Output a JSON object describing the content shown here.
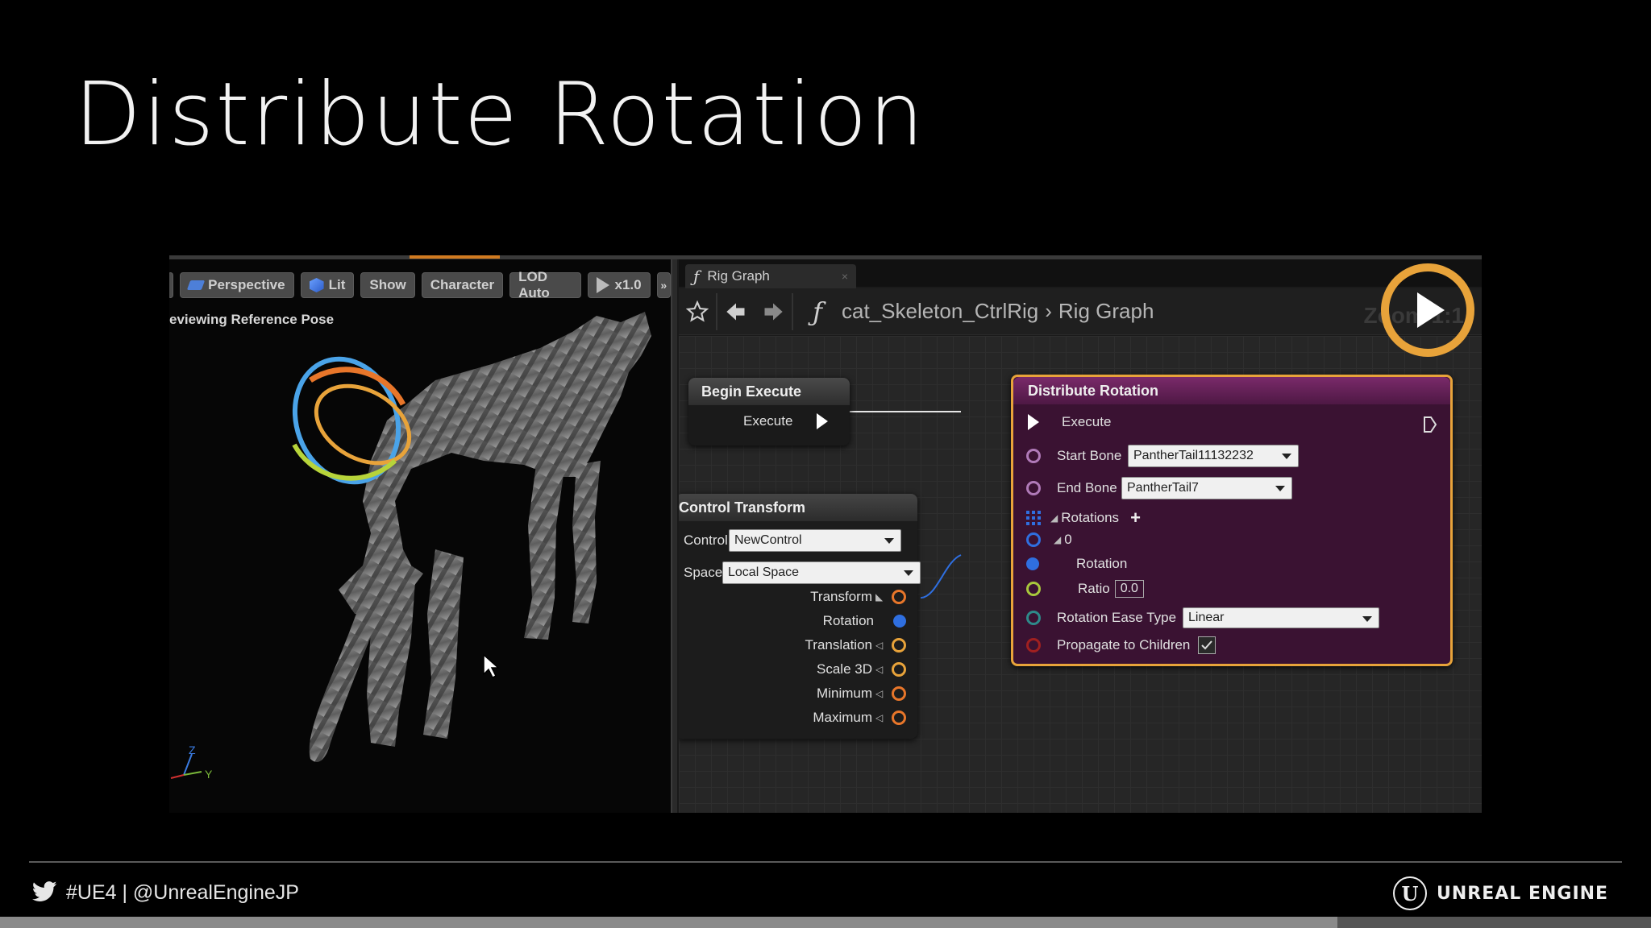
{
  "slide": {
    "title": "Distribute Rotation"
  },
  "viewport": {
    "toolbar": {
      "perspective": "Perspective",
      "lit": "Lit",
      "show": "Show",
      "character": "Character",
      "lod": "LOD Auto",
      "speed": "x1.0",
      "more": "»"
    },
    "status": "eviewing Reference Pose",
    "axis_z": "Z",
    "axis_y": "Y"
  },
  "graph": {
    "tab_label": "Rig Graph",
    "tab_close": "×",
    "breadcrumb": [
      "cat_Skeleton_CtrlRig",
      "Rig Graph"
    ],
    "breadcrumb_sep": "›",
    "zoom_text": "Zoom 1:1",
    "begin_execute": {
      "title": "Begin Execute",
      "execute_label": "Execute"
    },
    "control_transform": {
      "title": "Control Transform",
      "control_label": "Control",
      "control_value": "NewControl",
      "space_label": "Space",
      "space_value": "Local Space",
      "outputs": [
        "Transform",
        "Rotation",
        "Translation",
        "Scale 3D",
        "Minimum",
        "Maximum"
      ]
    },
    "distribute_rotation": {
      "title": "Distribute Rotation",
      "execute_label": "Execute",
      "start_bone_label": "Start Bone",
      "start_bone_value": "PantherTail11132232",
      "end_bone_label": "End Bone",
      "end_bone_value": "PantherTail7",
      "rotations_label": "Rotations",
      "add_symbol": "+",
      "index_label": "0",
      "rotation_label": "Rotation",
      "ratio_label": "Ratio",
      "ratio_value": "0.0",
      "ease_label": "Rotation Ease Type",
      "ease_value": "Linear",
      "propagate_label": "Propagate to Children",
      "propagate_checked": true
    }
  },
  "footer": {
    "hashtag": "#UE4 | @UnrealEngineJP",
    "brand": "UNREAL ENGINE",
    "brand_glyph": "U",
    "progress": 0.81
  },
  "colors": {
    "accent_orange": "#e8a33a",
    "node_purple": "#5a1f4e",
    "pin_purple": "#b07ab8",
    "pin_blue": "#2f6fe0",
    "pin_orange": "#e8762a",
    "pin_green": "#a8c83c"
  }
}
